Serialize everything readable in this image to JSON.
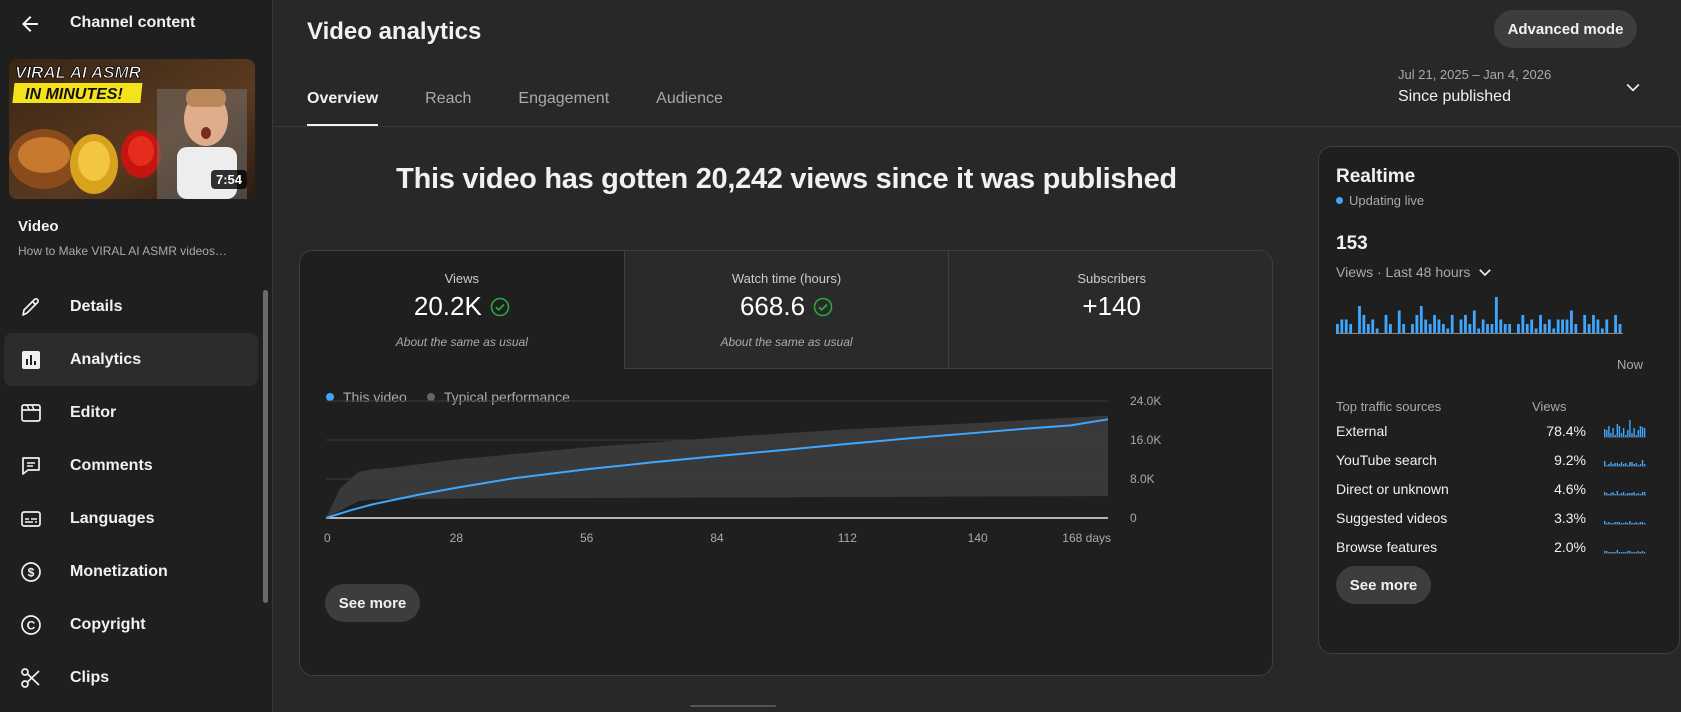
{
  "sidebar": {
    "title": "Channel content",
    "thumbnail": {
      "headline_line1": "VIRAL AI ASMR",
      "headline_line2": "IN MINUTES!",
      "duration": "7:54"
    },
    "video_label": "Video",
    "video_title": "How to Make VIRAL AI ASMR videos…",
    "nav": [
      {
        "label": "Details",
        "icon": "pencil-icon"
      },
      {
        "label": "Analytics",
        "icon": "bar-chart-icon"
      },
      {
        "label": "Editor",
        "icon": "clapperboard-icon"
      },
      {
        "label": "Comments",
        "icon": "comment-icon"
      },
      {
        "label": "Languages",
        "icon": "subtitles-icon"
      },
      {
        "label": "Monetization",
        "icon": "dollar-icon"
      },
      {
        "label": "Copyright",
        "icon": "copyright-icon"
      },
      {
        "label": "Clips",
        "icon": "scissors-icon"
      }
    ]
  },
  "header": {
    "title": "Video analytics",
    "advanced_mode": "Advanced mode",
    "tabs": [
      "Overview",
      "Reach",
      "Engagement",
      "Audience"
    ],
    "date_range": "Jul 21, 2025 – Jan 4, 2026",
    "date_label": "Since published"
  },
  "main": {
    "headline": "This video has gotten 20,242 views since it was published",
    "metrics": [
      {
        "label": "Views",
        "value": "20.2K",
        "note": "About the same as usual",
        "check": true
      },
      {
        "label": "Watch time (hours)",
        "value": "668.6",
        "note": "About the same as usual",
        "check": true
      },
      {
        "label": "Subscribers",
        "value": "+140",
        "note": "",
        "check": false
      }
    ],
    "see_more": "See more"
  },
  "colors": {
    "accent": "#3ea6ff",
    "check": "#2ba640",
    "typical": "#555555"
  },
  "chart_data": {
    "type": "line",
    "x_tick_labels": [
      "0",
      "28",
      "56",
      "84",
      "112",
      "140",
      "168 days"
    ],
    "y_tick_labels": [
      "0",
      "8.0K",
      "16.0K",
      "24.0K"
    ],
    "ylim": [
      0,
      24000
    ],
    "xlim": [
      0,
      168
    ],
    "series": [
      {
        "name": "This video",
        "x": [
          0,
          5,
          10,
          20,
          28,
          40,
          56,
          70,
          84,
          100,
          112,
          126,
          140,
          150,
          160,
          168
        ],
        "y": [
          0,
          1500,
          2800,
          4800,
          6200,
          8100,
          10000,
          11400,
          12700,
          14100,
          15200,
          16400,
          17500,
          18300,
          19000,
          20242
        ]
      },
      {
        "name": "Typical performance",
        "x": [
          0,
          3,
          7,
          10,
          14,
          28,
          56,
          84,
          112,
          140,
          168
        ],
        "y_low": [
          0,
          1500,
          3500,
          3800,
          3900,
          4000,
          4100,
          4200,
          4300,
          4400,
          4500
        ],
        "y_high": [
          0,
          6000,
          9500,
          10000,
          10300,
          12000,
          14500,
          16500,
          18200,
          19500,
          21000
        ]
      }
    ],
    "grid": true,
    "legend": "top-left"
  },
  "realtime": {
    "title": "Realtime",
    "status": "Updating live",
    "count": "153",
    "period": "Views · Last 48 hours",
    "now_label": "Now",
    "hourly_views": [
      2,
      3,
      3,
      2,
      0,
      6,
      4,
      2,
      3,
      1,
      0,
      4,
      2,
      0,
      5,
      2,
      0,
      2,
      4,
      6,
      3,
      2,
      4,
      3,
      2,
      1,
      4,
      0,
      3,
      4,
      2,
      5,
      1,
      3,
      2,
      2,
      8,
      3,
      2,
      2,
      0,
      2,
      4,
      2,
      3,
      1,
      4,
      2,
      3,
      1,
      3,
      3,
      3,
      5,
      2,
      0,
      4,
      2,
      4,
      3,
      1,
      3,
      0,
      4,
      2
    ],
    "th_sources": "Top traffic sources",
    "th_views": "Views",
    "sources": [
      {
        "name": "External",
        "pct": "78.4%"
      },
      {
        "name": "YouTube search",
        "pct": "9.2%"
      },
      {
        "name": "Direct or unknown",
        "pct": "4.6%"
      },
      {
        "name": "Suggested videos",
        "pct": "3.3%"
      },
      {
        "name": "Browse features",
        "pct": "2.0%"
      }
    ],
    "see_more": "See more"
  }
}
